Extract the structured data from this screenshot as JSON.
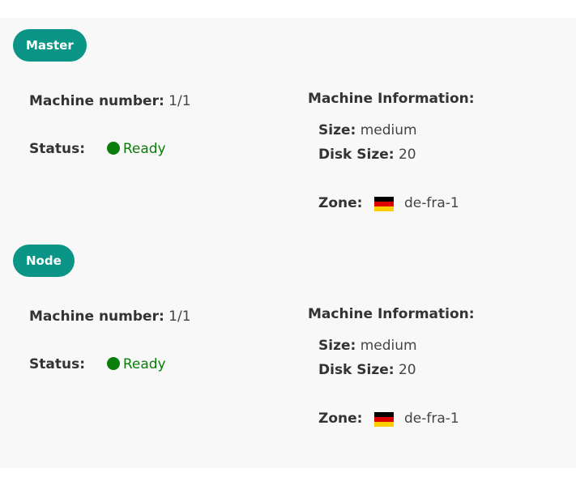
{
  "colors": {
    "badge": "#0a9587",
    "status_ready": "#0a7d0a",
    "flag": [
      "#000000",
      "#dd0000",
      "#ffce00"
    ]
  },
  "sections": [
    {
      "title": "Master",
      "machine_number_label": "Machine number:",
      "machine_number": "1/1",
      "status_label": "Status:",
      "status": "Ready",
      "info_title": "Machine Information:",
      "size_label": "Size:",
      "size": "medium",
      "disk_label": "Disk Size:",
      "disk": "20",
      "zone_label": "Zone:",
      "zone_icon": "germany-flag-icon",
      "zone": "de-fra-1"
    },
    {
      "title": "Node",
      "machine_number_label": "Machine number:",
      "machine_number": "1/1",
      "status_label": "Status:",
      "status": "Ready",
      "info_title": "Machine Information:",
      "size_label": "Size:",
      "size": "medium",
      "disk_label": "Disk Size:",
      "disk": "20",
      "zone_label": "Zone:",
      "zone_icon": "germany-flag-icon",
      "zone": "de-fra-1"
    }
  ]
}
